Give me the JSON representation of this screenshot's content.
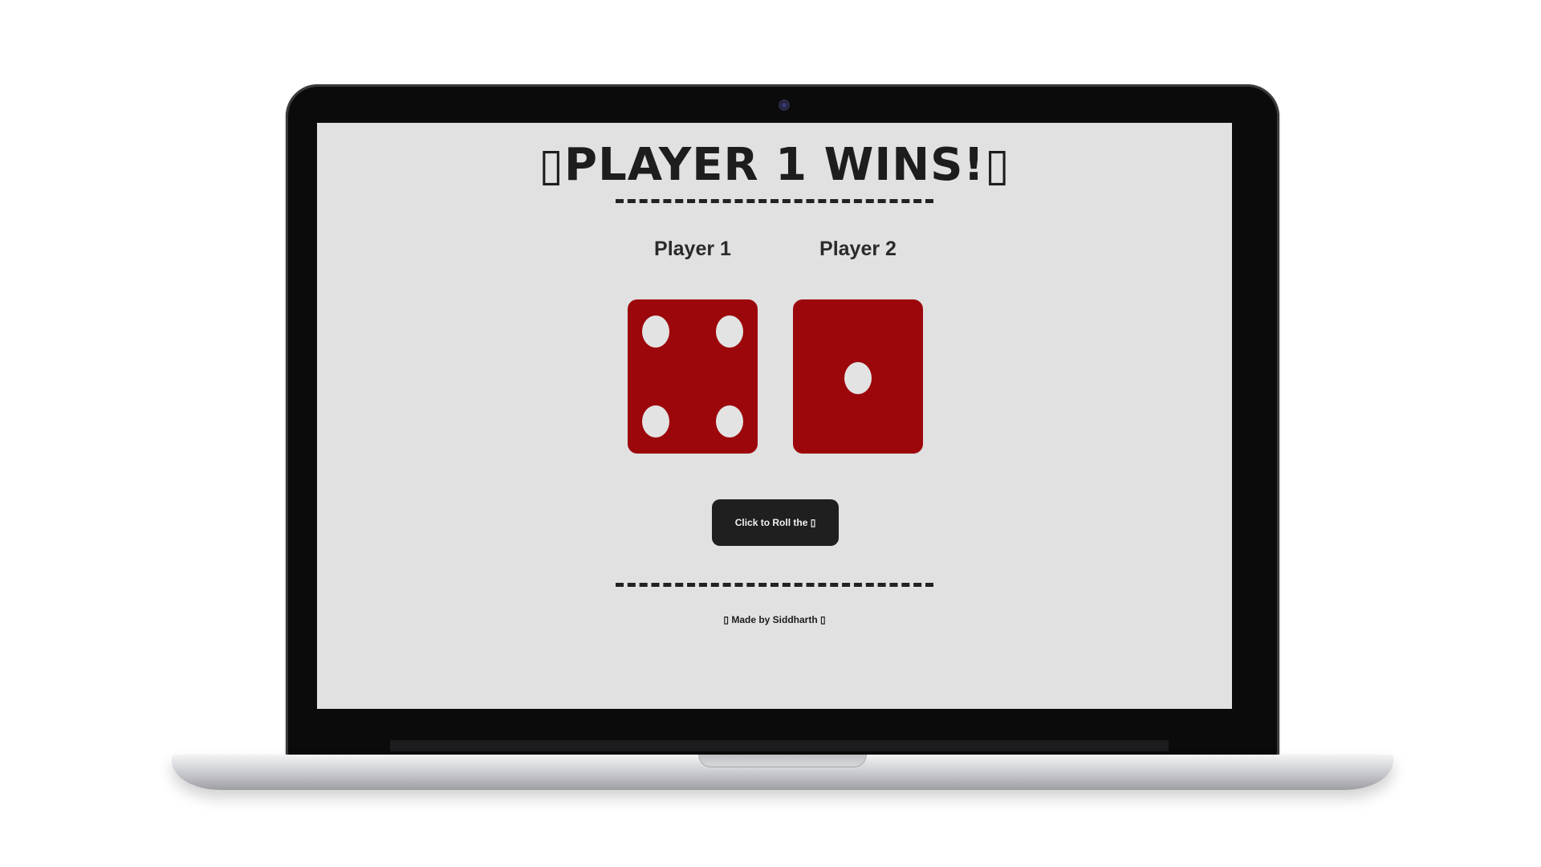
{
  "page": {
    "title": "▯PLAYER 1 WINS!▯",
    "players": [
      {
        "label": "Player 1",
        "die_value": 4
      },
      {
        "label": "Player 2",
        "die_value": 1
      }
    ],
    "roll_button_label": "Click to Roll the ▯",
    "footer_text": "▯ Made by Siddharth ▯"
  },
  "colors": {
    "die": "#9c070c",
    "pip": "#e3e3e3",
    "background": "#e1e1e1",
    "button": "#1f1f1f"
  }
}
